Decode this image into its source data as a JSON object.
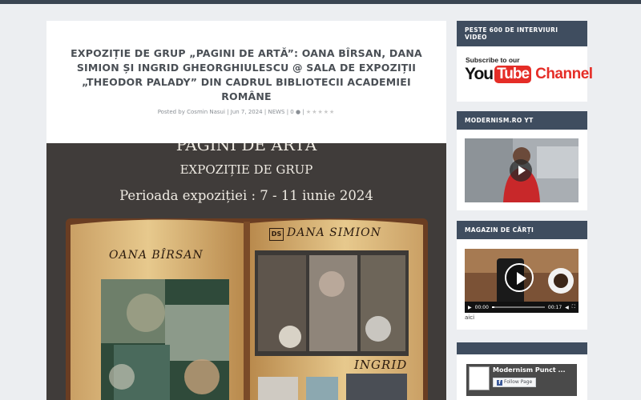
{
  "post": {
    "title": "EXPOZIȚIE DE GRUP „PAGINI DE ARTĂ”: OANA BÎRSAN, DANA SIMION ȘI INGRID GHEORGHIULESCU @ SALA DE EXPOZIȚII „THEODOR PALADY” DIN CADRUL BIBLIOTECII ACADEMIEI ROMÂNE",
    "meta_prefix": "Posted by",
    "author": "Cosmin Nasui",
    "date": "Jun 7, 2024",
    "category": "NEWS",
    "comments": "0",
    "stars": "★★★★★"
  },
  "hero": {
    "line1": "PAGINI DE ARTĂ",
    "line2": "EXPOZIȚIE DE GRUP",
    "line3": "Perioada expoziției : 7 - 11 iunie 2024",
    "left_page_name": "OANA BÎRSAN",
    "right_page_logo": "DS",
    "right_page_name": "DANA SIMION",
    "bottom_name": "INGRID"
  },
  "sidebar": {
    "w1_title": "PESTE 600 DE INTERVIURI VIDEO",
    "w1_subscribe": "Subscribe to our",
    "w1_you": "You",
    "w1_tube": "Tube",
    "w1_channel": "Channel",
    "w2_title": "MODERNISM.RO YT",
    "w3_title": "MAGAZIN DE CĂRȚI",
    "w3_time_start": "00:00",
    "w3_time_end": "00:17",
    "w3_caption": "aici",
    "w4_page_name": "Modernism Punct ...",
    "w4_follow": "Follow Page"
  },
  "colors": {
    "widget_header": "#3f4d5f",
    "youtube_red": "#e52d27",
    "hero_bg": "#403c3a"
  }
}
